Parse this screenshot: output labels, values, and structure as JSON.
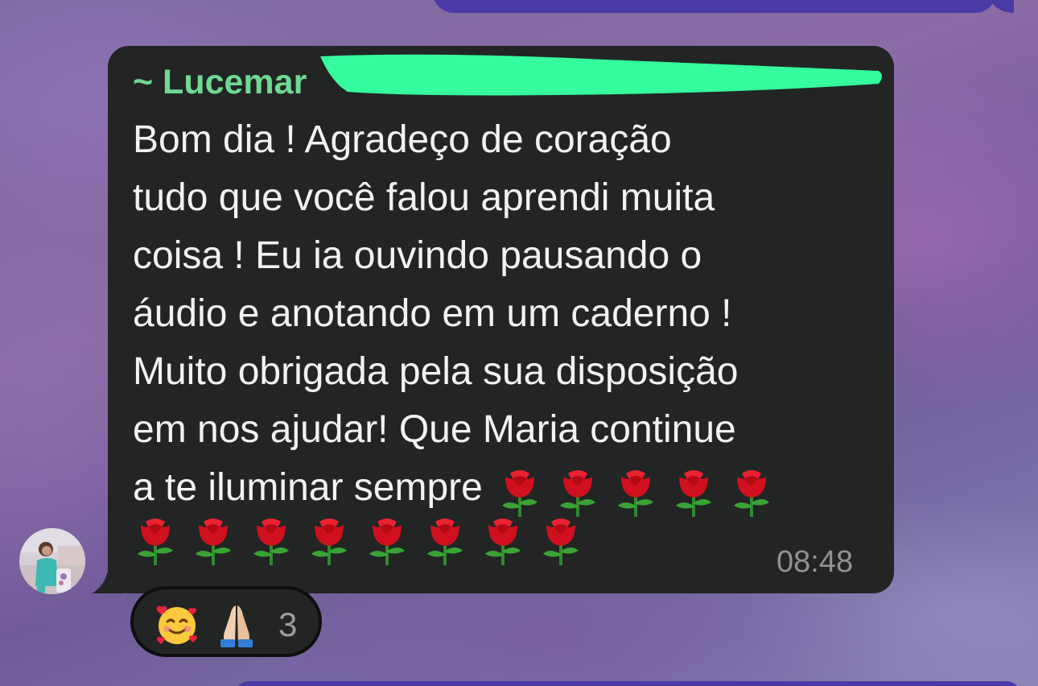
{
  "chat": {
    "message": {
      "sender": "~ Lucemar",
      "lines": [
        "Bom dia ! Agradeço de coração",
        "tudo que você falou aprendi muita",
        "coisa ! Eu ia ouvindo pausando o",
        "áudio e anotando em um caderno !",
        "Muito obrigada pela sua disposição",
        "em nos ajudar! Que Maria continue",
        "a te iluminar sempre"
      ],
      "emoji_inline": "rose",
      "emoji_inline_count": 5,
      "emoji_row_count": 8,
      "time": "08:48"
    },
    "reactions": {
      "emojis": [
        "smiling-face-with-hearts",
        "folded-hands"
      ],
      "count": "3"
    }
  },
  "colors": {
    "bubble_bg": "#222524",
    "sender_name": "#6fd991",
    "redaction_marker": "#35fd9d",
    "outgoing_bubble": "#4a3aa6",
    "timestamp": "#8f9290"
  }
}
